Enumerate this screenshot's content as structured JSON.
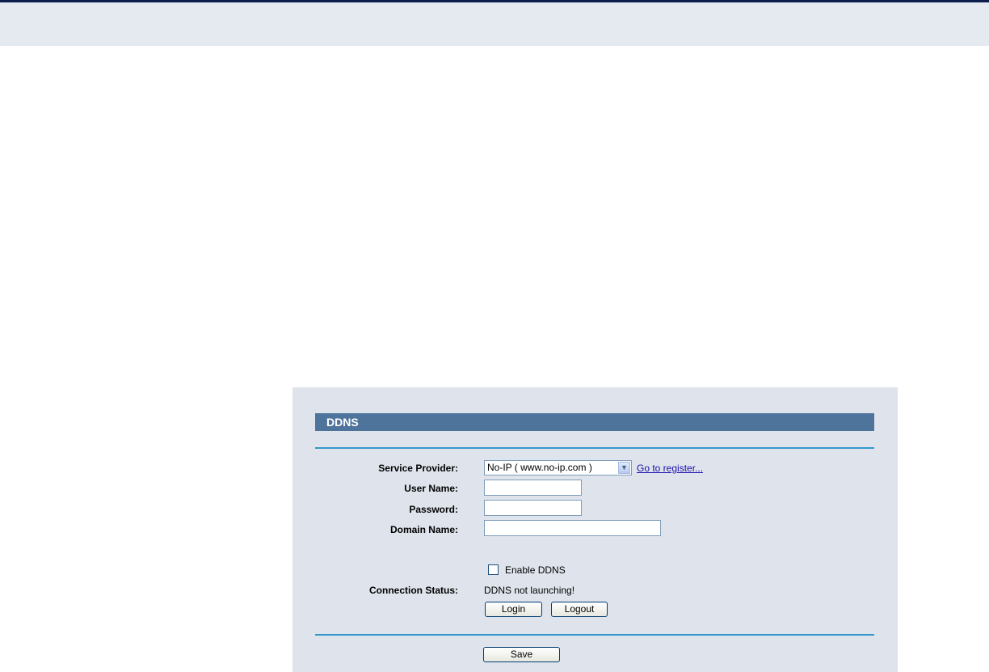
{
  "header": {},
  "panel": {
    "title": "DDNS",
    "service_provider": {
      "label": "Service Provider:",
      "selected": "No-IP ( www.no-ip.com )",
      "register_link": "Go to register..."
    },
    "user_name": {
      "label": "User Name:",
      "value": ""
    },
    "password": {
      "label": "Password:",
      "value": ""
    },
    "domain_name": {
      "label": "Domain Name:",
      "value": ""
    },
    "enable_ddns": {
      "label": "Enable DDNS",
      "checked": false
    },
    "connection_status": {
      "label": "Connection Status:",
      "value": "DDNS not launching!"
    },
    "buttons": {
      "login": "Login",
      "logout": "Logout",
      "save": "Save"
    }
  },
  "colors": {
    "top_border": "#0b1d4a",
    "top_band": "#e5e9f0",
    "panel_bg": "#dfe4ec",
    "title_bar": "#4f749c",
    "rule": "#3399cc",
    "link": "#1a0dab"
  }
}
